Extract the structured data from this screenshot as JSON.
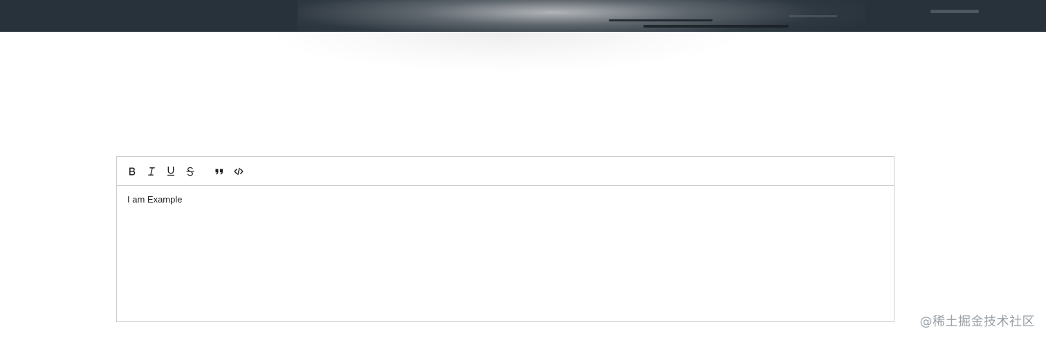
{
  "editor": {
    "toolbar": {
      "buttons": [
        {
          "name": "bold",
          "icon": "bold-icon"
        },
        {
          "name": "italic",
          "icon": "italic-icon"
        },
        {
          "name": "underline",
          "icon": "underline-icon"
        },
        {
          "name": "strike",
          "icon": "strikethrough-icon"
        },
        {
          "name": "blockquote",
          "icon": "quote-icon"
        },
        {
          "name": "code",
          "icon": "code-icon"
        }
      ]
    },
    "content": "I am Example"
  },
  "watermark": "@稀土掘金技术社区",
  "colors": {
    "hero_band": "#27323b",
    "editor_border": "#cccccc",
    "text": "#222222"
  }
}
